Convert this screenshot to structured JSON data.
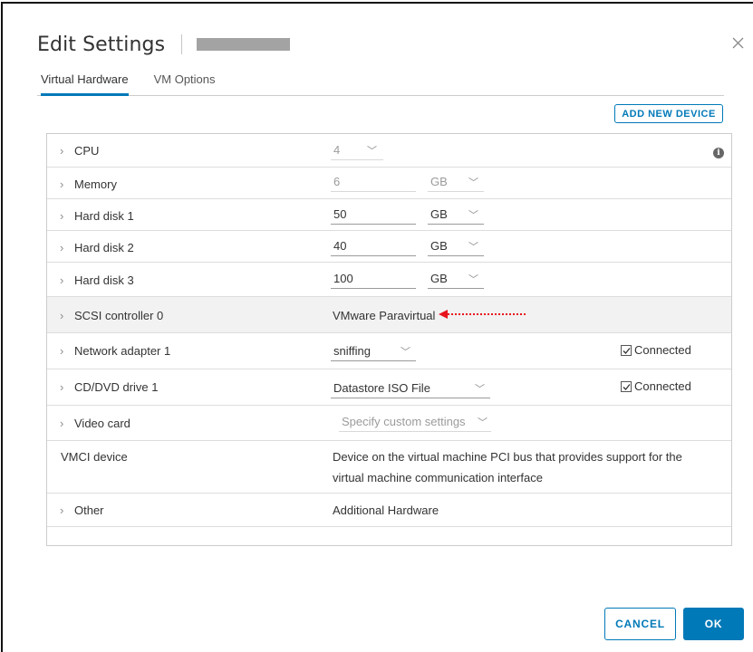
{
  "header": {
    "title": "Edit Settings"
  },
  "tabs": [
    {
      "label": "Virtual Hardware"
    },
    {
      "label": "VM Options"
    }
  ],
  "add_device_label": "ADD NEW DEVICE",
  "rows": {
    "cpu": {
      "label": "CPU",
      "value": "4"
    },
    "memory": {
      "label": "Memory",
      "value": "6",
      "unit": "GB"
    },
    "disk1": {
      "label": "Hard disk 1",
      "value": "50",
      "unit": "GB"
    },
    "disk2": {
      "label": "Hard disk 2",
      "value": "40",
      "unit": "GB"
    },
    "disk3": {
      "label": "Hard disk 3",
      "value": "100",
      "unit": "GB"
    },
    "scsi": {
      "label": "SCSI controller 0",
      "value": "VMware Paravirtual"
    },
    "network": {
      "label": "Network adapter 1",
      "value": "sniffing",
      "connected_label": "Connected"
    },
    "cddvd": {
      "label": "CD/DVD drive 1",
      "value": "Datastore ISO File",
      "connected_label": "Connected"
    },
    "video": {
      "label": "Video card",
      "value": "Specify custom settings"
    },
    "vmci": {
      "label": "VMCI device",
      "line1": "Device on the virtual machine PCI bus that provides support for the",
      "line2": "virtual machine communication interface"
    },
    "other": {
      "label": "Other",
      "value": "Additional Hardware"
    }
  },
  "footer": {
    "cancel_label": "CANCEL",
    "ok_label": "OK"
  },
  "colors": {
    "accent": "#0079b8",
    "annotation_arrow": "#e8141c"
  }
}
